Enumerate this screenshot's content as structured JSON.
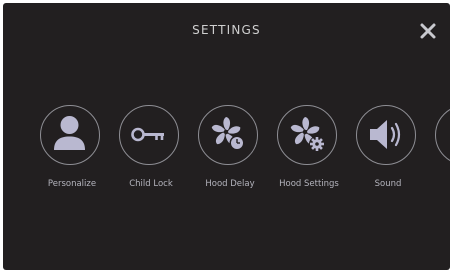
{
  "header": {
    "title": "SETTINGS",
    "close_icon": "close-icon"
  },
  "colors": {
    "background": "#221f20",
    "icon": "#b9b8d0",
    "ring": "#8e8e94",
    "text": "#cfcfcf"
  },
  "settings_items": [
    {
      "label": "Personalize",
      "icon": "person-icon"
    },
    {
      "label": "Child Lock",
      "icon": "key-icon"
    },
    {
      "label": "Hood Delay",
      "icon": "fan-timer-icon"
    },
    {
      "label": "Hood Settings",
      "icon": "fan-gear-icon"
    },
    {
      "label": "Sound",
      "icon": "speaker-icon"
    }
  ]
}
